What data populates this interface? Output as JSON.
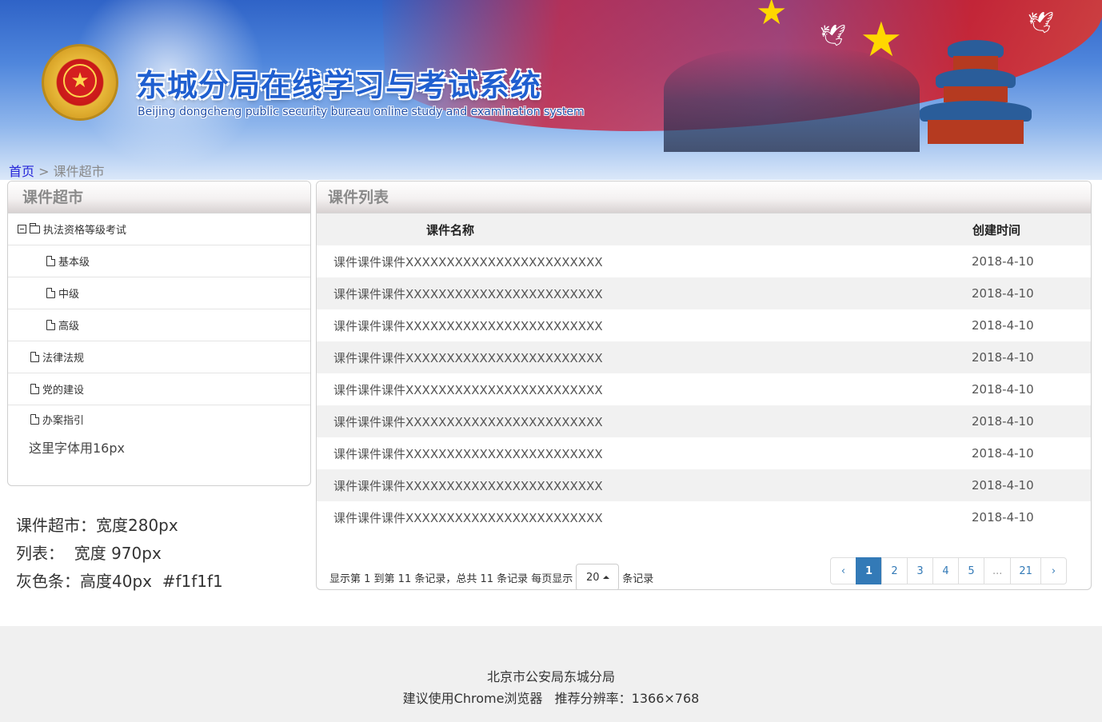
{
  "header": {
    "title_cn": "东城分局在线学习与考试系统",
    "title_en": "Beijing dongcheng public security bureau online study and examination system"
  },
  "breadcrumb": {
    "home": "首页",
    "separator": ">",
    "current": "课件超市"
  },
  "left_panel": {
    "title": "课件超市",
    "tree": [
      {
        "label": "执法资格等级考试",
        "type": "folder",
        "expanded": true
      },
      {
        "label": "基本级",
        "type": "doc"
      },
      {
        "label": "中级",
        "type": "doc"
      },
      {
        "label": "高级",
        "type": "doc"
      },
      {
        "label": "法律法规",
        "type": "doc"
      },
      {
        "label": "党的建设",
        "type": "doc"
      },
      {
        "label": "办案指引",
        "type": "doc"
      }
    ],
    "note": "这里字体用16px"
  },
  "spec_notes": [
    "课件超市：宽度280px",
    "列表：  宽度 970px",
    "灰色条：高度40px  #f1f1f1"
  ],
  "list_panel": {
    "title": "课件列表",
    "columns": [
      "课件名称",
      "创建时间"
    ],
    "rows": [
      [
        "课件课件课件XXXXXXXXXXXXXXXXXXXXXXXX",
        "2018-4-10"
      ],
      [
        "课件课件课件XXXXXXXXXXXXXXXXXXXXXXXX",
        "2018-4-10"
      ],
      [
        "课件课件课件XXXXXXXXXXXXXXXXXXXXXXXX",
        "2018-4-10"
      ],
      [
        "课件课件课件XXXXXXXXXXXXXXXXXXXXXXXX",
        "2018-4-10"
      ],
      [
        "课件课件课件XXXXXXXXXXXXXXXXXXXXXXXX",
        "2018-4-10"
      ],
      [
        "课件课件课件XXXXXXXXXXXXXXXXXXXXXXXX",
        "2018-4-10"
      ],
      [
        "课件课件课件XXXXXXXXXXXXXXXXXXXXXXXX",
        "2018-4-10"
      ],
      [
        "课件课件课件XXXXXXXXXXXXXXXXXXXXXXXX",
        "2018-4-10"
      ],
      [
        "课件课件课件XXXXXXXXXXXXXXXXXXXXXXXX",
        "2018-4-10"
      ]
    ],
    "pager": {
      "info_prefix": "显示第 1 到第 11 条记录，总共 11 条记录 每页显示",
      "page_size": "20",
      "info_suffix": "条记录",
      "prev": "‹",
      "pages": [
        "1",
        "2",
        "3",
        "4",
        "5",
        "...",
        "21"
      ],
      "next": "›",
      "active_page": "1"
    }
  },
  "footer": {
    "line1": "北京市公安局东城分局",
    "line2": "建议使用Chrome浏览器   推荐分辨率：1366×768"
  },
  "colors": {
    "gray_bar": "#f1f1f1",
    "link_blue": "#2323d8",
    "pager_active": "#337ab7"
  },
  "icons": [
    "minus-square-icon",
    "folder-icon",
    "document-icon",
    "caret-up-icon"
  ]
}
